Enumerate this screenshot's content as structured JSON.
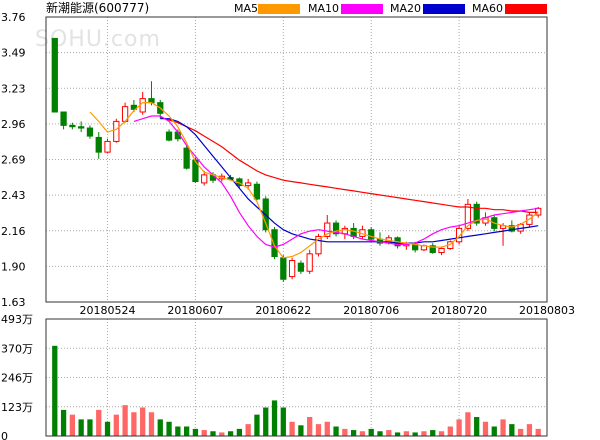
{
  "title": "新潮能源(600777)",
  "watermark": "SOHU.com",
  "legend": [
    {
      "name": "MA5",
      "color": "#ff9900"
    },
    {
      "name": "MA10",
      "color": "#ff00ff"
    },
    {
      "name": "MA20",
      "color": "#0000cc"
    },
    {
      "name": "MA60",
      "color": "#ff0000"
    }
  ],
  "colors": {
    "up": "#ff0000",
    "down": "#008000",
    "volume_up": "#ff6666",
    "grid": "#aaaaaa",
    "frame": "#333333"
  },
  "chart_data": [
    {
      "type": "candlestick",
      "y_ticks": [
        "3.76",
        "3.49",
        "3.23",
        "2.96",
        "2.69",
        "2.43",
        "2.16",
        "1.90",
        "1.63"
      ],
      "ylim": [
        1.63,
        3.76
      ],
      "x_tick_labels": [
        "20180524",
        "20180607",
        "20180622",
        "20180706",
        "20180720",
        "20180803"
      ],
      "x_tick_index": [
        6,
        16,
        26,
        36,
        46,
        56
      ],
      "ohlc": [
        [
          3.6,
          3.6,
          3.05,
          3.05
        ],
        [
          3.05,
          3.05,
          2.92,
          2.95
        ],
        [
          2.95,
          2.97,
          2.92,
          2.94
        ],
        [
          2.94,
          2.98,
          2.9,
          2.93
        ],
        [
          2.93,
          2.95,
          2.85,
          2.87
        ],
        [
          2.86,
          2.9,
          2.7,
          2.75
        ],
        [
          2.75,
          2.85,
          2.74,
          2.83
        ],
        [
          2.83,
          3.0,
          2.82,
          2.98
        ],
        [
          2.98,
          3.12,
          2.97,
          3.09
        ],
        [
          3.1,
          3.14,
          3.05,
          3.07
        ],
        [
          3.05,
          3.2,
          3.03,
          3.15
        ],
        [
          3.15,
          3.28,
          3.1,
          3.12
        ],
        [
          3.12,
          3.14,
          3.0,
          3.04
        ],
        [
          2.9,
          2.92,
          2.83,
          2.84
        ],
        [
          2.9,
          2.92,
          2.83,
          2.85
        ],
        [
          2.78,
          2.8,
          2.62,
          2.63
        ],
        [
          2.69,
          2.71,
          2.52,
          2.53
        ],
        [
          2.52,
          2.61,
          2.5,
          2.58
        ],
        [
          2.58,
          2.6,
          2.52,
          2.54
        ],
        [
          2.55,
          2.59,
          2.53,
          2.57
        ],
        [
          2.56,
          2.58,
          2.54,
          2.55
        ],
        [
          2.55,
          2.56,
          2.48,
          2.5
        ],
        [
          2.5,
          2.55,
          2.47,
          2.52
        ],
        [
          2.51,
          2.53,
          2.39,
          2.4
        ],
        [
          2.4,
          2.42,
          2.15,
          2.17
        ],
        [
          2.17,
          2.19,
          1.95,
          1.97
        ],
        [
          1.96,
          1.98,
          1.78,
          1.8
        ],
        [
          1.82,
          1.96,
          1.8,
          1.94
        ],
        [
          1.92,
          1.94,
          1.84,
          1.86
        ],
        [
          1.86,
          2.02,
          1.84,
          1.99
        ],
        [
          1.99,
          2.14,
          1.97,
          2.12
        ],
        [
          2.12,
          2.28,
          2.1,
          2.22
        ],
        [
          2.22,
          2.24,
          2.12,
          2.14
        ],
        [
          2.14,
          2.2,
          2.1,
          2.18
        ],
        [
          2.18,
          2.22,
          2.1,
          2.12
        ],
        [
          2.12,
          2.2,
          2.1,
          2.17
        ],
        [
          2.17,
          2.19,
          2.08,
          2.1
        ],
        [
          2.1,
          2.15,
          2.05,
          2.07
        ],
        [
          2.07,
          2.13,
          2.06,
          2.11
        ],
        [
          2.11,
          2.12,
          2.03,
          2.05
        ],
        [
          2.05,
          2.08,
          2.02,
          2.06
        ],
        [
          2.06,
          2.08,
          2.0,
          2.02
        ],
        [
          2.02,
          2.06,
          2.01,
          2.05
        ],
        [
          2.05,
          2.07,
          1.99,
          2.0
        ],
        [
          2.0,
          2.04,
          1.98,
          2.03
        ],
        [
          2.03,
          2.09,
          2.02,
          2.08
        ],
        [
          2.08,
          2.2,
          2.06,
          2.18
        ],
        [
          2.18,
          2.4,
          2.16,
          2.36
        ],
        [
          2.36,
          2.38,
          2.2,
          2.22
        ],
        [
          2.22,
          2.3,
          2.2,
          2.26
        ],
        [
          2.26,
          2.28,
          2.16,
          2.18
        ],
        [
          2.18,
          2.22,
          2.05,
          2.2
        ],
        [
          2.2,
          2.24,
          2.15,
          2.16
        ],
        [
          2.16,
          2.22,
          2.14,
          2.21
        ],
        [
          2.21,
          2.3,
          2.19,
          2.28
        ],
        [
          2.28,
          2.34,
          2.26,
          2.33
        ]
      ],
      "ma5": [
        null,
        null,
        null,
        null,
        3.05,
        2.98,
        2.9,
        2.92,
        2.98,
        3.06,
        3.12,
        3.12,
        3.08,
        3.02,
        2.94,
        2.82,
        2.68,
        2.6,
        2.58,
        2.56,
        2.54,
        2.52,
        2.48,
        2.38,
        2.22,
        2.05,
        1.96,
        1.97,
        2.0,
        2.05,
        2.1,
        2.14,
        2.16,
        2.17,
        2.16,
        2.14,
        2.12,
        2.1,
        2.09,
        2.08,
        2.07,
        2.06,
        2.05,
        2.04,
        2.04,
        2.06,
        2.12,
        2.2,
        2.24,
        2.25,
        2.22,
        2.2,
        2.19,
        2.21,
        2.25,
        2.3
      ],
      "ma10": [
        null,
        null,
        null,
        null,
        null,
        null,
        null,
        null,
        null,
        2.98,
        3.0,
        3.02,
        3.02,
        2.98,
        2.9,
        2.8,
        2.72,
        2.64,
        2.58,
        2.52,
        2.42,
        2.3,
        2.2,
        2.12,
        2.06,
        2.04,
        2.06,
        2.1,
        2.14,
        2.16,
        2.17,
        2.16,
        2.15,
        2.14,
        2.12,
        2.1,
        2.09,
        2.08,
        2.07,
        2.06,
        2.06,
        2.07,
        2.1,
        2.14,
        2.17,
        2.19,
        2.2,
        2.22,
        2.24,
        2.26,
        2.28,
        2.29,
        2.3,
        2.31,
        2.32,
        2.33
      ],
      "ma20": [
        null,
        null,
        null,
        null,
        null,
        null,
        null,
        null,
        null,
        null,
        null,
        null,
        3.0,
        3.0,
        2.98,
        2.94,
        2.88,
        2.8,
        2.72,
        2.64,
        2.56,
        2.48,
        2.4,
        2.34,
        2.28,
        2.22,
        2.17,
        2.14,
        2.12,
        2.1,
        2.09,
        2.08,
        2.08,
        2.08,
        2.08,
        2.08,
        2.08,
        2.08,
        2.08,
        2.07,
        2.07,
        2.07,
        2.08,
        2.08,
        2.09,
        2.1,
        2.11,
        2.12,
        2.13,
        2.14,
        2.15,
        2.16,
        2.17,
        2.18,
        2.19,
        2.2
      ],
      "ma60": [
        null,
        null,
        null,
        null,
        null,
        null,
        null,
        null,
        null,
        null,
        null,
        null,
        3.01,
        2.99,
        2.97,
        2.94,
        2.91,
        2.87,
        2.83,
        2.79,
        2.74,
        2.69,
        2.65,
        2.61,
        2.58,
        2.56,
        2.54,
        2.53,
        2.52,
        2.51,
        2.5,
        2.49,
        2.48,
        2.47,
        2.46,
        2.45,
        2.44,
        2.43,
        2.42,
        2.41,
        2.4,
        2.39,
        2.38,
        2.37,
        2.36,
        2.35,
        2.34,
        2.34,
        2.33,
        2.33,
        2.32,
        2.32,
        2.31,
        2.31,
        2.3,
        2.3
      ]
    },
    {
      "type": "bar",
      "y_ticks": [
        "493万",
        "370万",
        "246万",
        "123万",
        "0"
      ],
      "ylim": [
        0,
        493
      ],
      "unit": "万",
      "volume": [
        380,
        110,
        90,
        70,
        70,
        110,
        60,
        90,
        130,
        100,
        120,
        100,
        70,
        60,
        40,
        40,
        30,
        25,
        20,
        15,
        20,
        30,
        50,
        90,
        120,
        150,
        120,
        60,
        45,
        80,
        50,
        60,
        40,
        30,
        25,
        20,
        30,
        20,
        25,
        15,
        20,
        15,
        20,
        25,
        20,
        40,
        70,
        100,
        80,
        60,
        40,
        70,
        50,
        30,
        50,
        30
      ],
      "volume_up": [
        false,
        false,
        true,
        false,
        false,
        true,
        false,
        true,
        true,
        true,
        true,
        true,
        false,
        false,
        false,
        false,
        false,
        true,
        false,
        true,
        false,
        false,
        true,
        false,
        false,
        false,
        false,
        true,
        false,
        true,
        true,
        true,
        false,
        true,
        false,
        true,
        false,
        false,
        true,
        false,
        true,
        false,
        true,
        false,
        true,
        true,
        true,
        true,
        false,
        true,
        false,
        true,
        false,
        true,
        true,
        true
      ]
    }
  ]
}
